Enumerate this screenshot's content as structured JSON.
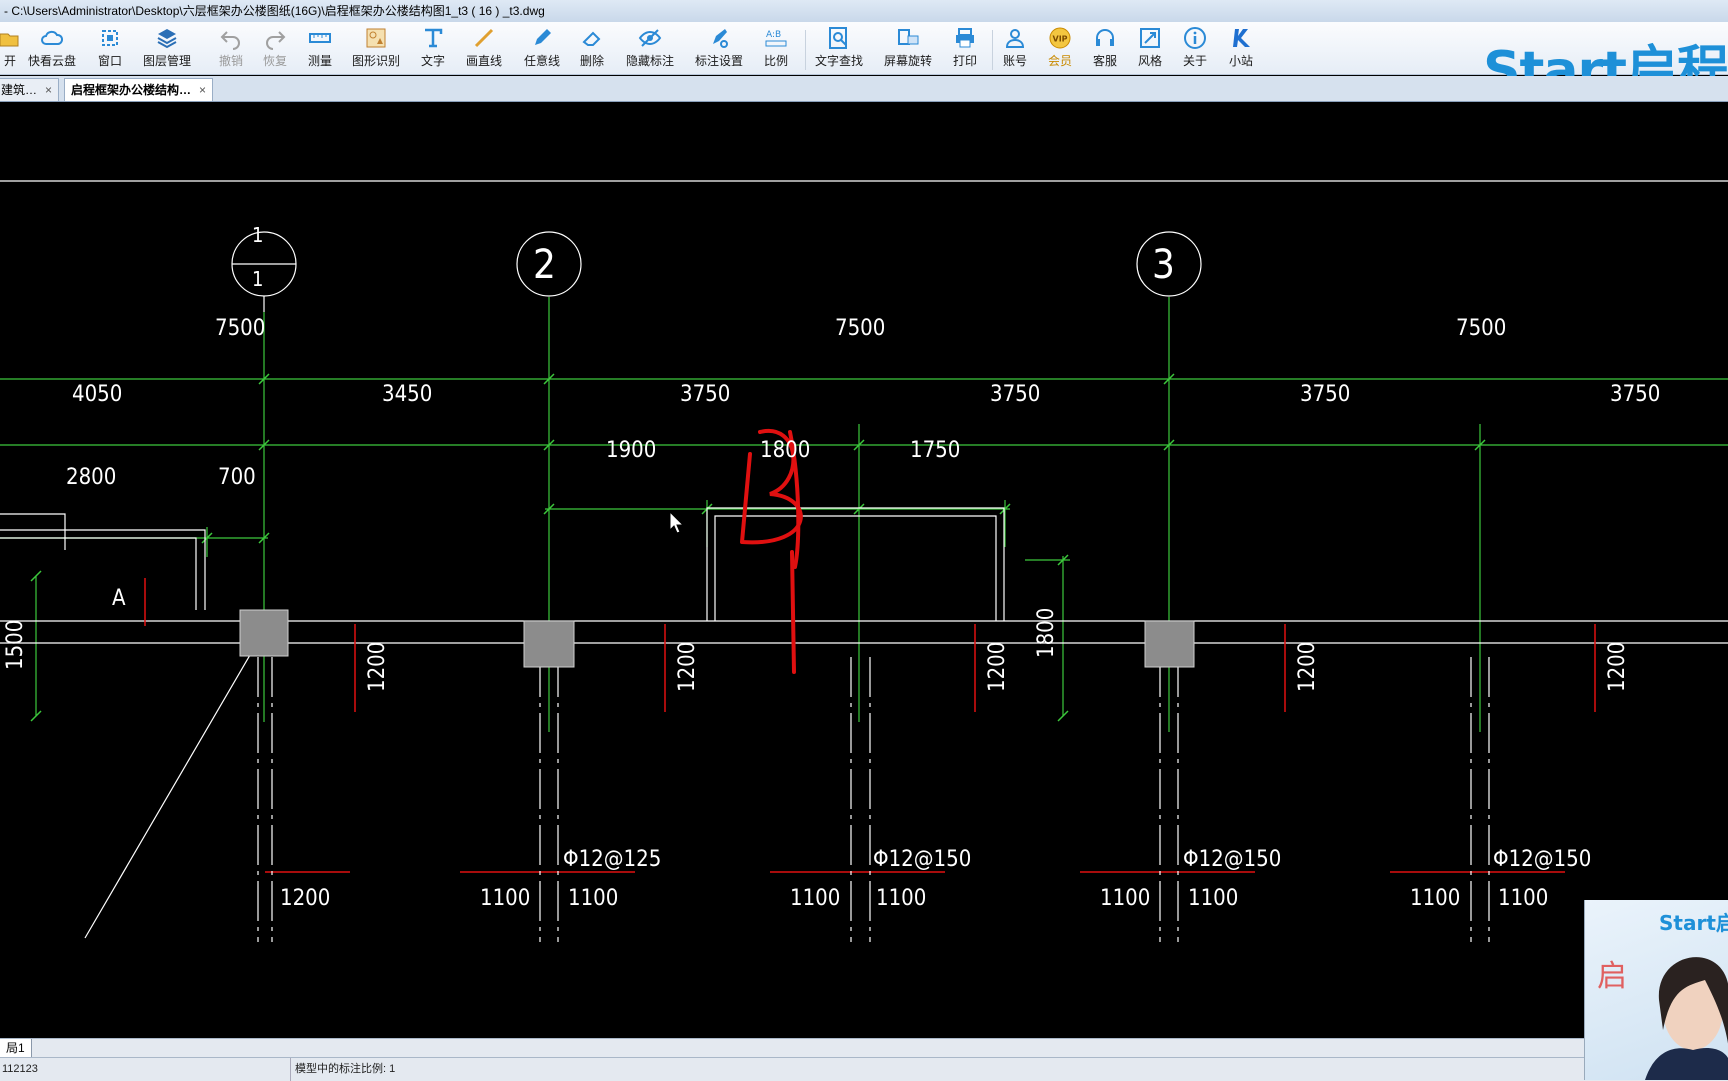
{
  "window": {
    "title": "- C:\\Users\\Administrator\\Desktop\\六层框架办公楼图纸(16G)\\启程框架办公楼结构图1_t3 ( 16 ) _t3.dwg"
  },
  "toolbar": {
    "items": [
      {
        "label": "开",
        "icon": "open-icon"
      },
      {
        "label": "快看云盘",
        "icon": "cloud-icon"
      },
      {
        "label": "窗口",
        "icon": "window-icon"
      },
      {
        "label": "图层管理",
        "icon": "layers-icon"
      },
      {
        "label": "撤销",
        "icon": "undo-icon"
      },
      {
        "label": "恢复",
        "icon": "redo-icon"
      },
      {
        "label": "测量",
        "icon": "measure-icon"
      },
      {
        "label": "图形识别",
        "icon": "shape-recognize-icon"
      },
      {
        "label": "文字",
        "icon": "text-icon"
      },
      {
        "label": "画直线",
        "icon": "line-icon"
      },
      {
        "label": "任意线",
        "icon": "pencil-icon"
      },
      {
        "label": "删除",
        "icon": "eraser-icon"
      },
      {
        "label": "隐藏标注",
        "icon": "eye-icon"
      },
      {
        "label": "标注设置",
        "icon": "annotation-settings-icon"
      },
      {
        "label": "比例",
        "icon": "scale-icon"
      },
      {
        "label": "文字查找",
        "icon": "text-search-icon"
      },
      {
        "label": "屏幕旋转",
        "icon": "rotate-icon"
      },
      {
        "label": "打印",
        "icon": "print-icon"
      },
      {
        "label": "账号",
        "icon": "user-icon"
      },
      {
        "label": "会员",
        "icon": "vip-icon"
      },
      {
        "label": "客服",
        "icon": "headset-icon"
      },
      {
        "label": "风格",
        "icon": "style-icon"
      },
      {
        "label": "关于",
        "icon": "info-icon"
      },
      {
        "label": "小站",
        "icon": "k-icon"
      }
    ],
    "vip_badge": "VIP",
    "scale_glyph": "A:B"
  },
  "logo": {
    "text": "Start启程"
  },
  "tabs": [
    {
      "label": "建筑…",
      "close": "×"
    },
    {
      "label": "启程框架办公楼结构…",
      "close": "×"
    }
  ],
  "drawing": {
    "axes": [
      {
        "label": "1",
        "sub": "1"
      },
      {
        "label": "2"
      },
      {
        "label": "3"
      }
    ],
    "dims_row1": [
      "7500",
      "7500",
      "7500"
    ],
    "dims_row2": [
      "4050",
      "3450",
      "3750",
      "3750",
      "3750",
      "3750"
    ],
    "dims_row3": [
      "2800",
      "700",
      "1900",
      "1800",
      "1750"
    ],
    "vertical_dims": [
      "1500",
      "1800"
    ],
    "beam_dims": [
      "1200",
      "1200",
      "1200",
      "1200",
      "1200"
    ],
    "rebar_labels": [
      "Φ12@125",
      "Φ12@150",
      "Φ12@150",
      "Φ12@150"
    ],
    "bottom_dims": [
      "1200",
      "1100",
      "1100",
      "1100",
      "1100",
      "1100",
      "1100",
      "1100",
      "1100"
    ],
    "room_label": "A",
    "handwriting": "B"
  },
  "layout_tab": "局1",
  "status": {
    "coord": "112123",
    "scale_text": "模型中的标注比例: 1"
  },
  "webcam": {
    "logo_text": "Start启",
    "overlay_text": "启"
  },
  "colors": {
    "accent": "#1e90d8",
    "cad_dim": "#3cc83c",
    "cad_line": "#ffffff",
    "cad_red": "#e01010",
    "column_fill": "#8c8c8c"
  }
}
